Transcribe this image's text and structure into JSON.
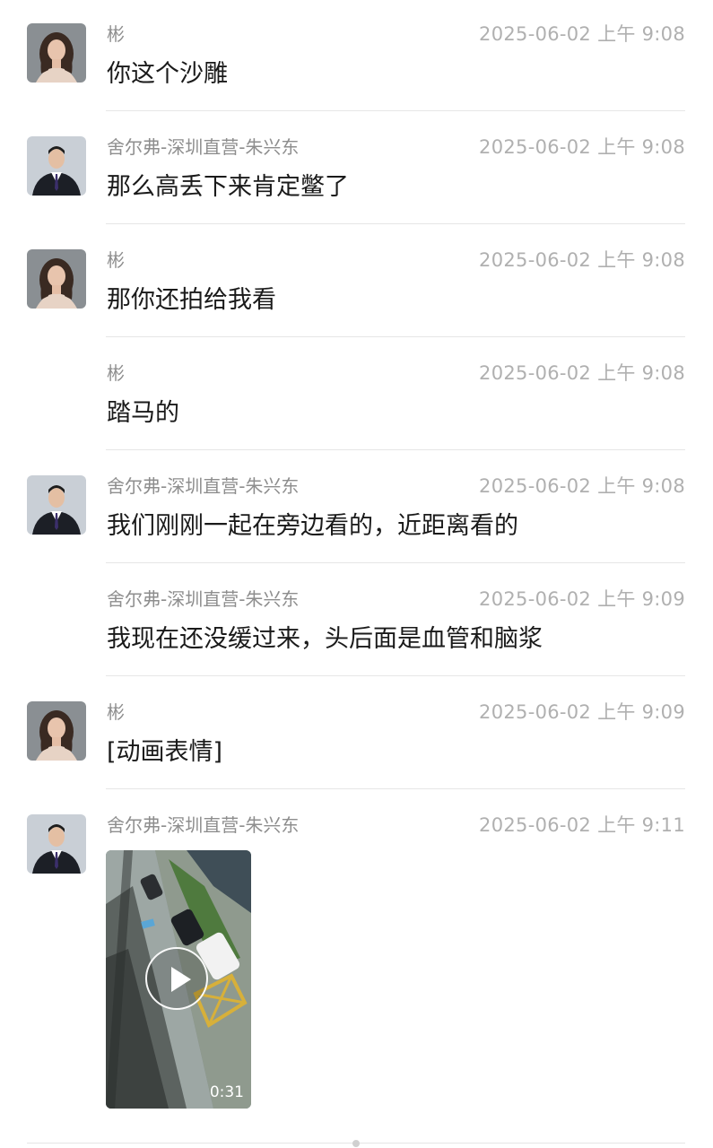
{
  "messages": [
    {
      "sender": "彬",
      "time": "2025-06-02 上午 9:08",
      "text": "你这个沙雕",
      "avatar": "woman-avatar"
    },
    {
      "sender": "舍尔弗-深圳直营-朱兴东",
      "time": "2025-06-02 上午 9:08",
      "text": "那么高丢下来肯定鳖了",
      "avatar": "man-avatar"
    },
    {
      "sender": "彬",
      "time": "2025-06-02 上午 9:08",
      "text": "那你还拍给我看",
      "avatar": "woman-avatar"
    },
    {
      "sender": "彬",
      "time": "2025-06-02 上午 9:08",
      "text": "踏马的"
    },
    {
      "sender": "舍尔弗-深圳直营-朱兴东",
      "time": "2025-06-02 上午 9:08",
      "text": "我们刚刚一起在旁边看的，近距离看的",
      "avatar": "man-avatar"
    },
    {
      "sender": "舍尔弗-深圳直营-朱兴东",
      "time": "2025-06-02 上午 9:09",
      "text": "我现在还没缓过来，头后面是血管和脑浆"
    },
    {
      "sender": "彬",
      "time": "2025-06-02 上午 9:09",
      "text": "[动画表情]",
      "avatar": "woman-avatar"
    },
    {
      "sender": "舍尔弗-深圳直营-朱兴东",
      "time": "2025-06-02 上午 9:11",
      "avatar": "man-avatar",
      "video": {
        "duration": "0:31"
      }
    }
  ]
}
